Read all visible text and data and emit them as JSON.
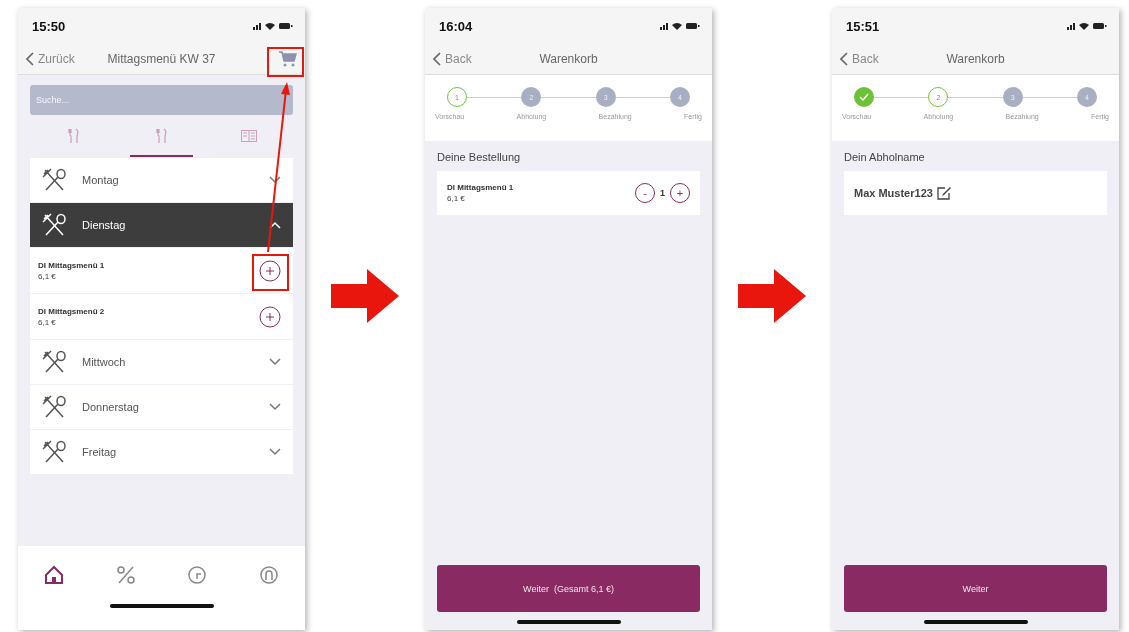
{
  "screens": [
    {
      "kind": "menu",
      "time": "15:50",
      "back": "Zurück",
      "title": "Mittagsmenü KW 37",
      "search": {
        "placeholder": "Suche..."
      },
      "tabs": [
        {
          "selected": false
        },
        {
          "selected": true
        },
        {
          "selected": false
        }
      ],
      "days": [
        {
          "name": "Montag",
          "expanded": false
        },
        {
          "name": "Dienstag",
          "expanded": true,
          "items": [
            {
              "name": "DI Mittagsmenü 1",
              "price": "6,1 €"
            },
            {
              "name": "DI Mittagsmenü 2",
              "price": "6,1 €"
            }
          ]
        },
        {
          "name": "Mittwoch",
          "expanded": false
        },
        {
          "name": "Donnerstag",
          "expanded": false
        },
        {
          "name": "Freitag",
          "expanded": false
        }
      ],
      "nav": [
        {
          "selected": true
        },
        {
          "selected": false
        },
        {
          "selected": false
        },
        {
          "selected": false
        }
      ]
    },
    {
      "kind": "cart",
      "time": "16:04",
      "back": "Back",
      "title": "Warenkorb",
      "steps": [
        {
          "number": "1",
          "label": "Vorschau",
          "completed": false,
          "active": true
        },
        {
          "number": "2",
          "label": "Abholung",
          "completed": false,
          "active": false
        },
        {
          "number": "3",
          "label": "Bezahlung",
          "completed": false,
          "active": false
        },
        {
          "number": "4",
          "label": "Fertig",
          "completed": false,
          "active": false
        }
      ],
      "section": "Deine Bestellung",
      "items": [
        {
          "name": "DI Mittagsmenü 1",
          "price": "6,1 €",
          "quantity": "1",
          "minus": "-",
          "plus": "+"
        }
      ],
      "button": "Weiter  (Gesamt 6,1 €)"
    },
    {
      "kind": "pickup",
      "time": "15:51",
      "back": "Back",
      "title": "Warenkorb",
      "steps": [
        {
          "label": "Vorschau",
          "completed": true
        },
        {
          "number": "2",
          "label": "Abholung",
          "completed": false,
          "active": true
        },
        {
          "number": "3",
          "label": "Bezahlung",
          "completed": false,
          "active": false
        },
        {
          "number": "4",
          "label": "Fertig",
          "completed": false,
          "active": false
        }
      ],
      "section": "Dein Abholname",
      "name": "Max Muster123",
      "button": "Weiter"
    }
  ]
}
